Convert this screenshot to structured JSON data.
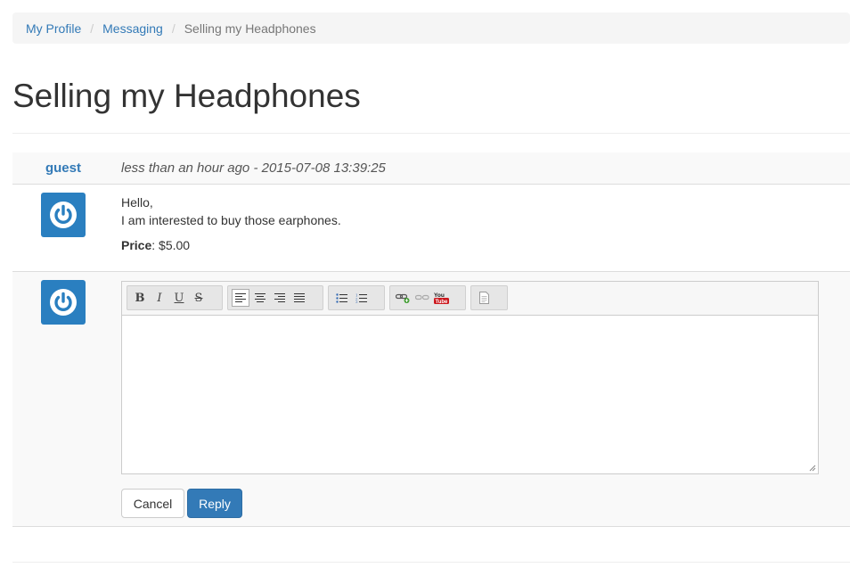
{
  "breadcrumb": {
    "items": [
      "My Profile",
      "Messaging"
    ],
    "current": "Selling my Headphones",
    "separator": "/"
  },
  "page": {
    "title": "Selling my Headphones"
  },
  "message": {
    "author": "guest",
    "date": "less than an hour ago - 2015-07-08 13:39:25",
    "lines": [
      "Hello,",
      "I am interested to buy those earphones."
    ],
    "price_label": "Price",
    "price_value": ": $5.00",
    "avatar_icon": "power-icon"
  },
  "reply": {
    "avatar_icon": "power-icon",
    "editor_value": "",
    "toolbar": {
      "groups": [
        [
          "bold-icon",
          "italic-icon",
          "underline-icon",
          "strikethrough-icon"
        ],
        [
          "align-left-icon",
          "align-center-icon",
          "align-right-icon",
          "align-justify-icon"
        ],
        [
          "bulleted-list-icon",
          "numbered-list-icon"
        ],
        [
          "link-icon",
          "unlink-icon",
          "youtube-icon"
        ],
        [
          "source-icon"
        ]
      ],
      "glyphs": {
        "bold": "B",
        "italic": "I",
        "underline": "U",
        "strike": "S"
      }
    },
    "cancel_label": "Cancel",
    "reply_label": "Reply"
  },
  "colors": {
    "link": "#337ab7",
    "primary": "#337ab7",
    "avatar": "#2a7fc0",
    "youtube": "#cc181e"
  }
}
